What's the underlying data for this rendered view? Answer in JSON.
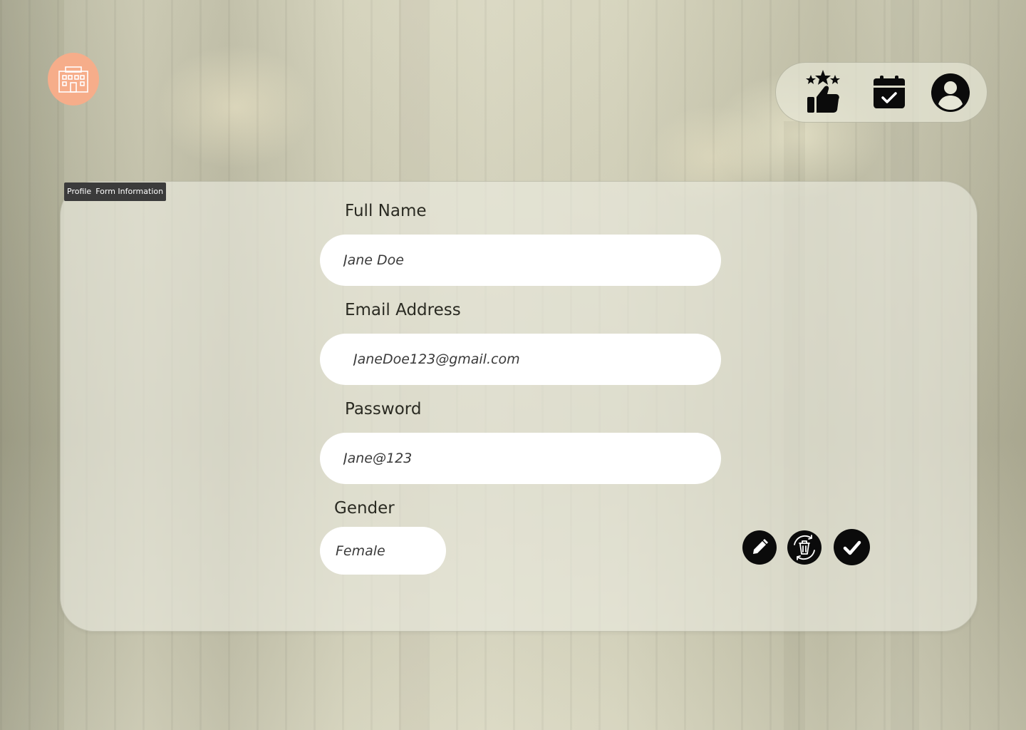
{
  "colors": {
    "logo_bg": "#f6ad8a",
    "button_bg": "#0b0b0b",
    "input_bg": "#ffffff"
  },
  "header": {
    "logo_icon": "hotel-building-icon",
    "nav": [
      {
        "icon": "reviews-thumbs-up-icon"
      },
      {
        "icon": "calendar-check-icon"
      },
      {
        "icon": "user-profile-icon"
      }
    ]
  },
  "card": {
    "tag": {
      "part1": "Profile",
      "part2": "Form Information"
    },
    "fields": {
      "full_name": {
        "label": "Full Name",
        "value": "Jane Doe"
      },
      "email": {
        "label": "Email Address",
        "value": "JaneDoe123@gmail.com"
      },
      "password": {
        "label": "Password",
        "value": "Jane@123"
      },
      "gender": {
        "label": "Gender",
        "value": "Female"
      }
    },
    "actions": [
      {
        "icon": "pencil-edit-icon"
      },
      {
        "icon": "delete-refresh-icon"
      },
      {
        "icon": "check-icon"
      }
    ]
  }
}
